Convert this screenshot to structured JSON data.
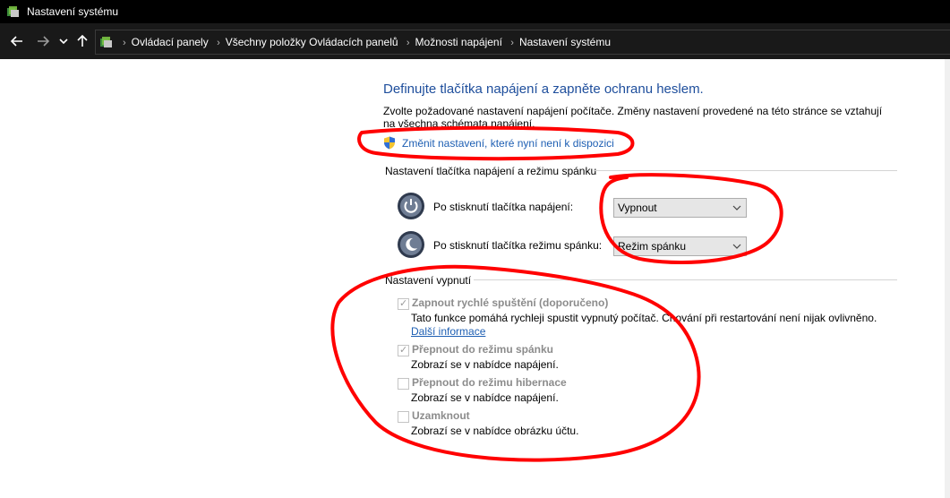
{
  "window": {
    "title": "Nastavení systému"
  },
  "nav": {
    "back_icon": "arrow-left-icon",
    "forward_icon": "arrow-right-icon",
    "recent_icon": "chevron-down-icon",
    "up_icon": "arrow-up-icon",
    "breadcrumbs": [
      "Ovládací panely",
      "Všechny položky Ovládacích panelů",
      "Možnosti napájení",
      "Nastavení systému"
    ]
  },
  "main": {
    "heading": "Definujte tlačítka napájení a zapněte ochranu heslem.",
    "description": "Zvolte požadované nastavení napájení počítače. Změny nastavení provedené na této stránce se vztahují na všechna schémata napájení.",
    "change_link": "Změnit nastavení, které nyní není k dispozici",
    "buttons_group": {
      "label": "Nastavení tlačítka napájení a režimu spánku",
      "power_button": {
        "label": "Po stisknutí tlačítka napájení:",
        "value": "Vypnout"
      },
      "sleep_button": {
        "label": "Po stisknutí tlačítka režimu spánku:",
        "value": "Režim spánku"
      }
    },
    "shutdown_group": {
      "label": "Nastavení vypnutí",
      "options": [
        {
          "label": "Zapnout rychlé spuštění (doporučeno)",
          "checked": true,
          "description": "Tato funkce pomáhá rychleji spustit vypnutý počítač. Chování při restartování není nijak ovlivněno.",
          "link": "Další informace"
        },
        {
          "label": "Přepnout do režimu spánku",
          "checked": true,
          "description": "Zobrazí se v nabídce napájení."
        },
        {
          "label": "Přepnout do režimu hibernace",
          "checked": false,
          "description": "Zobrazí se v nabídce napájení."
        },
        {
          "label": "Uzamknout",
          "checked": false,
          "description": "Zobrazí se v nabídce obrázku účtu."
        }
      ]
    }
  },
  "colors": {
    "heading": "#1e4e9c",
    "link": "#1e5fb3",
    "annotation": "#ff0000",
    "titlebar": "#000000"
  }
}
